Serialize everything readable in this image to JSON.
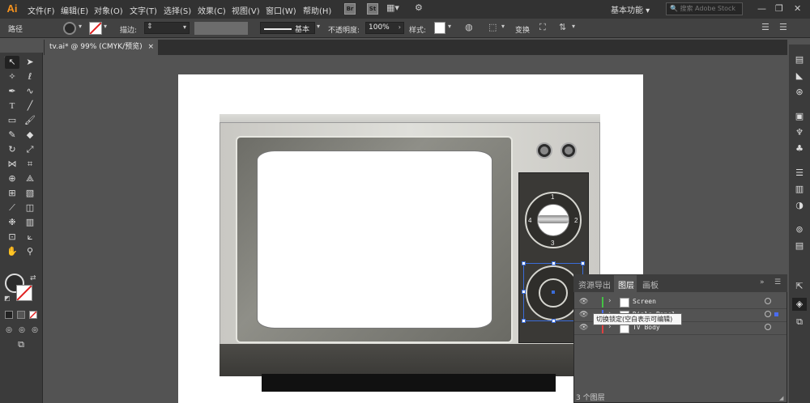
{
  "app": {
    "logo": "Ai"
  },
  "menu": [
    "文件(F)",
    "编辑(E)",
    "对象(O)",
    "文字(T)",
    "选择(S)",
    "效果(C)",
    "视图(V)",
    "窗口(W)",
    "帮助(H)"
  ],
  "bridge_btn": "Br",
  "stock_btn": "St",
  "workspace": "基本功能",
  "search_placeholder": "搜索 Adobe Stock",
  "window_controls": {
    "minimize": "—",
    "restore": "❐",
    "close": "✕"
  },
  "control": {
    "object_type": "路径",
    "stroke_label": "描边:",
    "profile": "基本",
    "opacity_label": "不透明度:",
    "opacity_value": "100%",
    "style_label": "样式:",
    "transform_btn": "变换"
  },
  "document_tab": {
    "title": "tv.ai* @ 99% (CMYK/预览)",
    "close": "×"
  },
  "tv": {
    "dial_numbers": [
      "1",
      "2",
      "3",
      "4"
    ]
  },
  "panel": {
    "tabs": [
      "资源导出",
      "图层",
      "画板"
    ],
    "active_tab": "图层",
    "layers": [
      {
        "name": "Screen",
        "color": "#44c244"
      },
      {
        "name": "Dials Panel",
        "color": "#4a6cf0"
      },
      {
        "name": "TV Body",
        "color": "#e04040"
      }
    ],
    "tooltip": "切换锁定(空白表示可编辑)",
    "footer": "3 个图层"
  },
  "colors": {
    "accent": "#f7931e",
    "selection": "#3a6cd9"
  }
}
